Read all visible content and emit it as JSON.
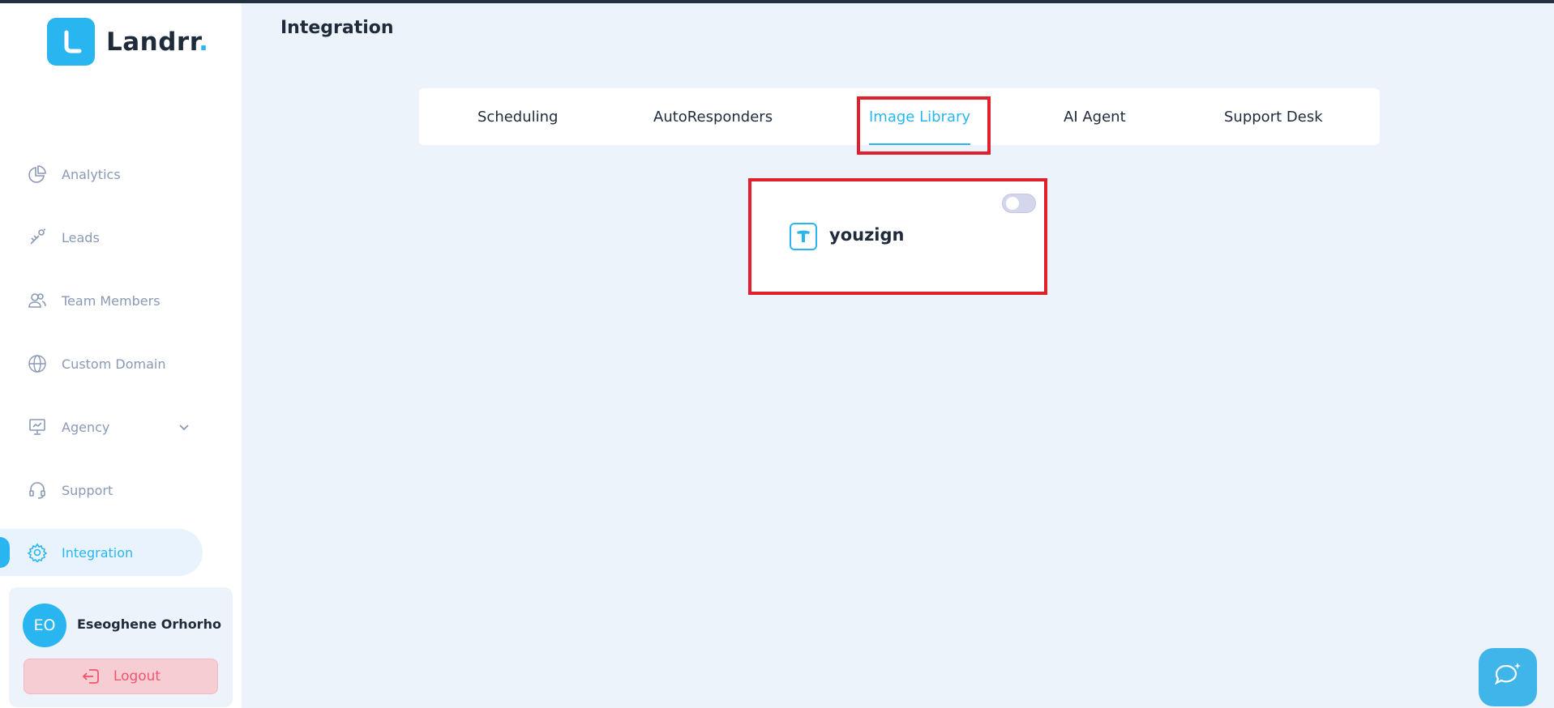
{
  "brand": {
    "name": "Landrr",
    "dot": ".",
    "color": "#29b6f0"
  },
  "sidebar": {
    "items": [
      {
        "label": "Analytics",
        "icon": "pie-chart-icon"
      },
      {
        "label": "Leads",
        "icon": "leads-icon"
      },
      {
        "label": "Team Members",
        "icon": "users-icon"
      },
      {
        "label": "Custom Domain",
        "icon": "globe-www-icon"
      },
      {
        "label": "Agency",
        "icon": "presentation-icon",
        "expandable": true
      },
      {
        "label": "Support",
        "icon": "headset-icon"
      },
      {
        "label": "Integration",
        "icon": "gear-icon",
        "active": true
      }
    ]
  },
  "user": {
    "initials": "EO",
    "name": "Eseoghene Orhorho",
    "logout_label": "Logout"
  },
  "main": {
    "title": "Integration",
    "tabs": [
      {
        "label": "Scheduling"
      },
      {
        "label": "AutoResponders"
      },
      {
        "label": "Image Library",
        "active": true
      },
      {
        "label": "AI Agent"
      },
      {
        "label": "Support Desk"
      }
    ],
    "integrations": [
      {
        "name": "youzign",
        "icon": "youzign-logo-icon",
        "enabled": false
      }
    ]
  },
  "colors": {
    "accent": "#29b6f0",
    "highlight": "#e0202d",
    "logout": "#f0566e"
  }
}
